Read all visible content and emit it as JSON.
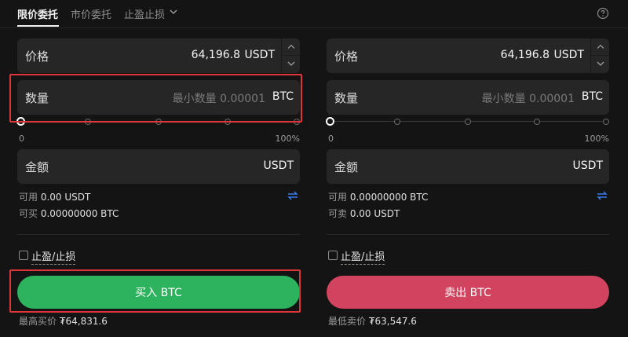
{
  "tabs": [
    {
      "label": "限价委托",
      "active": true
    },
    {
      "label": "市价委托",
      "active": false
    },
    {
      "label": "止盈止损",
      "active": false
    }
  ],
  "buy": {
    "price_label": "价格",
    "price_value": "64,196.8",
    "price_unit": "USDT",
    "qty_label": "数量",
    "qty_placeholder": "最小数量 0.00001",
    "qty_unit": "BTC",
    "slider_min": "0",
    "slider_max": "100%",
    "slider_percent": 0,
    "amount_label": "金额",
    "amount_unit": "USDT",
    "available_label": "可用",
    "available_value": "0.00 USDT",
    "can_trade_label": "可买",
    "can_trade_value": "0.00000000 BTC",
    "tpsl_label": "止盈/止损",
    "action_label": "买入 BTC",
    "best_price_label": "最高买价",
    "best_price_value": "₮64,831.6"
  },
  "sell": {
    "price_label": "价格",
    "price_value": "64,196.8",
    "price_unit": "USDT",
    "qty_label": "数量",
    "qty_placeholder": "最小数量 0.00001",
    "qty_unit": "BTC",
    "slider_min": "0",
    "slider_max": "100%",
    "slider_percent": 0,
    "amount_label": "金额",
    "amount_unit": "USDT",
    "available_label": "可用",
    "available_value": "0.00000000 BTC",
    "can_trade_label": "可卖",
    "can_trade_value": "0.00 USDT",
    "tpsl_label": "止盈/止损",
    "action_label": "卖出 BTC",
    "best_price_label": "最低卖价",
    "best_price_value": "₮63,547.6"
  },
  "colors": {
    "buy": "#2db35d",
    "sell": "#d2435f",
    "highlight": "#e0343b",
    "swap_icon": "#3b7df0"
  },
  "icons": {
    "tab_dropdown": "chevron-down-icon",
    "help": "help-circle-icon",
    "swap": "swap-arrows-icon",
    "stepper_up": "chevron-up-icon",
    "stepper_down": "chevron-down-icon"
  }
}
